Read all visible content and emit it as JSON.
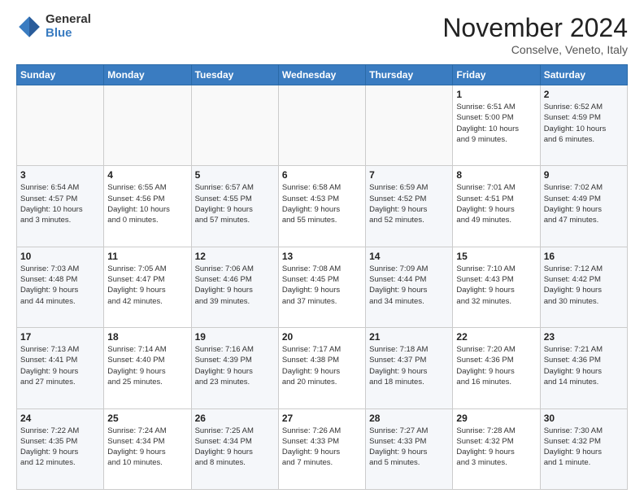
{
  "logo": {
    "general": "General",
    "blue": "Blue"
  },
  "title": "November 2024",
  "location": "Conselve, Veneto, Italy",
  "days_header": [
    "Sunday",
    "Monday",
    "Tuesday",
    "Wednesday",
    "Thursday",
    "Friday",
    "Saturday"
  ],
  "weeks": [
    [
      {
        "day": "",
        "info": ""
      },
      {
        "day": "",
        "info": ""
      },
      {
        "day": "",
        "info": ""
      },
      {
        "day": "",
        "info": ""
      },
      {
        "day": "",
        "info": ""
      },
      {
        "day": "1",
        "info": "Sunrise: 6:51 AM\nSunset: 5:00 PM\nDaylight: 10 hours\nand 9 minutes."
      },
      {
        "day": "2",
        "info": "Sunrise: 6:52 AM\nSunset: 4:59 PM\nDaylight: 10 hours\nand 6 minutes."
      }
    ],
    [
      {
        "day": "3",
        "info": "Sunrise: 6:54 AM\nSunset: 4:57 PM\nDaylight: 10 hours\nand 3 minutes."
      },
      {
        "day": "4",
        "info": "Sunrise: 6:55 AM\nSunset: 4:56 PM\nDaylight: 10 hours\nand 0 minutes."
      },
      {
        "day": "5",
        "info": "Sunrise: 6:57 AM\nSunset: 4:55 PM\nDaylight: 9 hours\nand 57 minutes."
      },
      {
        "day": "6",
        "info": "Sunrise: 6:58 AM\nSunset: 4:53 PM\nDaylight: 9 hours\nand 55 minutes."
      },
      {
        "day": "7",
        "info": "Sunrise: 6:59 AM\nSunset: 4:52 PM\nDaylight: 9 hours\nand 52 minutes."
      },
      {
        "day": "8",
        "info": "Sunrise: 7:01 AM\nSunset: 4:51 PM\nDaylight: 9 hours\nand 49 minutes."
      },
      {
        "day": "9",
        "info": "Sunrise: 7:02 AM\nSunset: 4:49 PM\nDaylight: 9 hours\nand 47 minutes."
      }
    ],
    [
      {
        "day": "10",
        "info": "Sunrise: 7:03 AM\nSunset: 4:48 PM\nDaylight: 9 hours\nand 44 minutes."
      },
      {
        "day": "11",
        "info": "Sunrise: 7:05 AM\nSunset: 4:47 PM\nDaylight: 9 hours\nand 42 minutes."
      },
      {
        "day": "12",
        "info": "Sunrise: 7:06 AM\nSunset: 4:46 PM\nDaylight: 9 hours\nand 39 minutes."
      },
      {
        "day": "13",
        "info": "Sunrise: 7:08 AM\nSunset: 4:45 PM\nDaylight: 9 hours\nand 37 minutes."
      },
      {
        "day": "14",
        "info": "Sunrise: 7:09 AM\nSunset: 4:44 PM\nDaylight: 9 hours\nand 34 minutes."
      },
      {
        "day": "15",
        "info": "Sunrise: 7:10 AM\nSunset: 4:43 PM\nDaylight: 9 hours\nand 32 minutes."
      },
      {
        "day": "16",
        "info": "Sunrise: 7:12 AM\nSunset: 4:42 PM\nDaylight: 9 hours\nand 30 minutes."
      }
    ],
    [
      {
        "day": "17",
        "info": "Sunrise: 7:13 AM\nSunset: 4:41 PM\nDaylight: 9 hours\nand 27 minutes."
      },
      {
        "day": "18",
        "info": "Sunrise: 7:14 AM\nSunset: 4:40 PM\nDaylight: 9 hours\nand 25 minutes."
      },
      {
        "day": "19",
        "info": "Sunrise: 7:16 AM\nSunset: 4:39 PM\nDaylight: 9 hours\nand 23 minutes."
      },
      {
        "day": "20",
        "info": "Sunrise: 7:17 AM\nSunset: 4:38 PM\nDaylight: 9 hours\nand 20 minutes."
      },
      {
        "day": "21",
        "info": "Sunrise: 7:18 AM\nSunset: 4:37 PM\nDaylight: 9 hours\nand 18 minutes."
      },
      {
        "day": "22",
        "info": "Sunrise: 7:20 AM\nSunset: 4:36 PM\nDaylight: 9 hours\nand 16 minutes."
      },
      {
        "day": "23",
        "info": "Sunrise: 7:21 AM\nSunset: 4:36 PM\nDaylight: 9 hours\nand 14 minutes."
      }
    ],
    [
      {
        "day": "24",
        "info": "Sunrise: 7:22 AM\nSunset: 4:35 PM\nDaylight: 9 hours\nand 12 minutes."
      },
      {
        "day": "25",
        "info": "Sunrise: 7:24 AM\nSunset: 4:34 PM\nDaylight: 9 hours\nand 10 minutes."
      },
      {
        "day": "26",
        "info": "Sunrise: 7:25 AM\nSunset: 4:34 PM\nDaylight: 9 hours\nand 8 minutes."
      },
      {
        "day": "27",
        "info": "Sunrise: 7:26 AM\nSunset: 4:33 PM\nDaylight: 9 hours\nand 7 minutes."
      },
      {
        "day": "28",
        "info": "Sunrise: 7:27 AM\nSunset: 4:33 PM\nDaylight: 9 hours\nand 5 minutes."
      },
      {
        "day": "29",
        "info": "Sunrise: 7:28 AM\nSunset: 4:32 PM\nDaylight: 9 hours\nand 3 minutes."
      },
      {
        "day": "30",
        "info": "Sunrise: 7:30 AM\nSunset: 4:32 PM\nDaylight: 9 hours\nand 1 minute."
      }
    ]
  ]
}
